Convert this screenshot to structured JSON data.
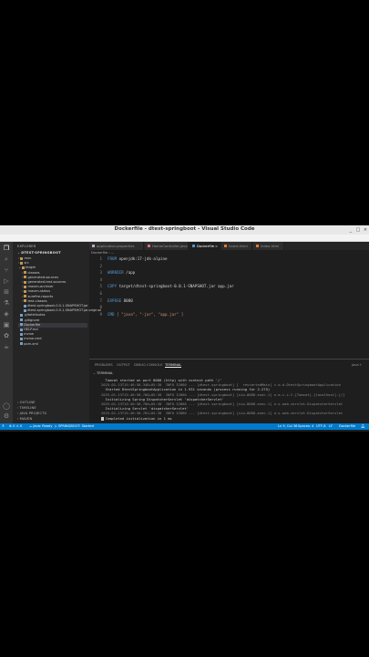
{
  "window": {
    "title": "Dockerfile - dtest-springboot - Visual Studio Code",
    "controls": [
      "_",
      "□",
      "×"
    ]
  },
  "menu": [
    "File",
    "Edit",
    "Selection",
    "View",
    "Go",
    "Run",
    "Terminal",
    "Help"
  ],
  "sidebar": {
    "header": "EXPLORER",
    "project": "DTEST-SPRINGBOOT",
    "items": [
      {
        "label": "mvn",
        "indent": 1,
        "twisty": "›"
      },
      {
        "label": "src",
        "indent": 1,
        "twisty": "›"
      },
      {
        "label": "target",
        "indent": 1,
        "twisty": "⌄"
      },
      {
        "label": "classes",
        "indent": 2,
        "twisty": "›"
      },
      {
        "label": "generated-sources",
        "indent": 2,
        "twisty": "›"
      },
      {
        "label": "generated-test-sources",
        "indent": 2,
        "twisty": "›"
      },
      {
        "label": "maven-archiver",
        "indent": 2,
        "twisty": "›"
      },
      {
        "label": "maven-status",
        "indent": 2,
        "twisty": "›"
      },
      {
        "label": "surefire-reports",
        "indent": 2,
        "twisty": "›"
      },
      {
        "label": "test-classes",
        "indent": 2,
        "twisty": "›"
      },
      {
        "label": "dtest-springboot-0.0.1-SNAPSHOT.jar",
        "indent": 2,
        "twisty": ""
      },
      {
        "label": "dtest-springboot-0.0.1-SNAPSHOT.jar.original",
        "indent": 2,
        "twisty": ""
      },
      {
        "label": ".gitattributes",
        "indent": 1,
        "twisty": ""
      },
      {
        "label": ".gitignore",
        "indent": 1,
        "twisty": ""
      },
      {
        "label": "Dockerfile",
        "indent": 1,
        "twisty": "",
        "selected": true
      },
      {
        "label": "HELP.md",
        "indent": 1,
        "twisty": ""
      },
      {
        "label": "mvnw",
        "indent": 1,
        "twisty": ""
      },
      {
        "label": "mvnw.cmd",
        "indent": 1,
        "twisty": ""
      },
      {
        "label": "pom.xml",
        "indent": 1,
        "twisty": ""
      }
    ],
    "sections": [
      "OUTLINE",
      "TIMELINE",
      "JAVA PROJECTS",
      "MAVEN"
    ]
  },
  "tabs": [
    {
      "label": "application.properties",
      "color": "#c5a5c5"
    },
    {
      "label": "HomeController.java",
      "color": "#e06c75"
    },
    {
      "label": "Dockerfile",
      "color": "#4e94ce",
      "active": true
    },
    {
      "label": "home.html",
      "color": "#e37933"
    },
    {
      "label": "index.html",
      "color": "#e37933"
    }
  ],
  "breadcrumb": "Dockerfile › ...",
  "editor": {
    "lines": [
      {
        "num": "1",
        "kw": "FROM",
        "rest": " openjdk:17-jdk-alpine"
      },
      {
        "num": "2",
        "kw": "",
        "rest": ""
      },
      {
        "num": "3",
        "kw": "WORKDIR",
        "rest": " /app"
      },
      {
        "num": "4",
        "kw": "",
        "rest": ""
      },
      {
        "num": "5",
        "kw": "COPY",
        "rest": " target/dtest-springboot-0.0.1-SNAPSHOT.jar app.jar"
      },
      {
        "num": "6",
        "kw": "",
        "rest": ""
      },
      {
        "num": "7",
        "kw": "EXPOSE",
        "rest": " 8080"
      },
      {
        "num": "8",
        "kw": "",
        "rest": ""
      },
      {
        "num": "9",
        "kw": "CMD",
        "rest": " [ \"java\", \"-jar\", \"app.jar\" ]"
      }
    ]
  },
  "panel": {
    "tabs": [
      "PROBLEMS",
      "OUTPUT",
      "DEBUG CONSOLE",
      "TERMINAL"
    ],
    "active_tab": "TERMINAL",
    "terminal_label": "TERMINAL",
    "shell": "java",
    "lines": [
      "  Tomcat started on port 8080 (http) with context path '/'",
      "2025-01-13T15:46:58.340+05:30  INFO 32860 --- [dtest-springboot] [  restartedMain] c.d.d.DtestSpringbootApplication",
      "  Started DtestSpringbootApplication in 1.931 seconds (process running for 2.275)",
      "2025-01-13T15:46:58.700+05:30  INFO 32860 --- [dtest-springboot] [nio-8080-exec-1] o.a.c.c.C.[Tomcat].[localhost].[/]",
      "  Initializing Spring DispatcherServlet 'dispatcherServlet'",
      "2025-01-13T15:46:58.700+05:30  INFO 32860 --- [dtest-springboot] [nio-8080-exec-1] o.s.web.servlet.DispatcherServlet",
      "  Initializing Servlet 'dispatcherServlet'",
      "2025-01-13T15:46:58.701+05:30  INFO 32860 --- [dtest-springboot] [nio-8080-exec-1] o.s.web.servlet.DispatcherServlet",
      "  Completed initialization in 1 ms"
    ]
  },
  "status": {
    "left": "⊗ 0 ⚠ 0",
    "java": "☕ Java: Ready",
    "run": "▷ SPRINGBOOT: Started",
    "ln_col": "Ln 9, Col 36",
    "spaces": "Spaces: 4",
    "encoding": "UTF-8",
    "eol": "LF",
    "lang": "Dockerfile"
  }
}
